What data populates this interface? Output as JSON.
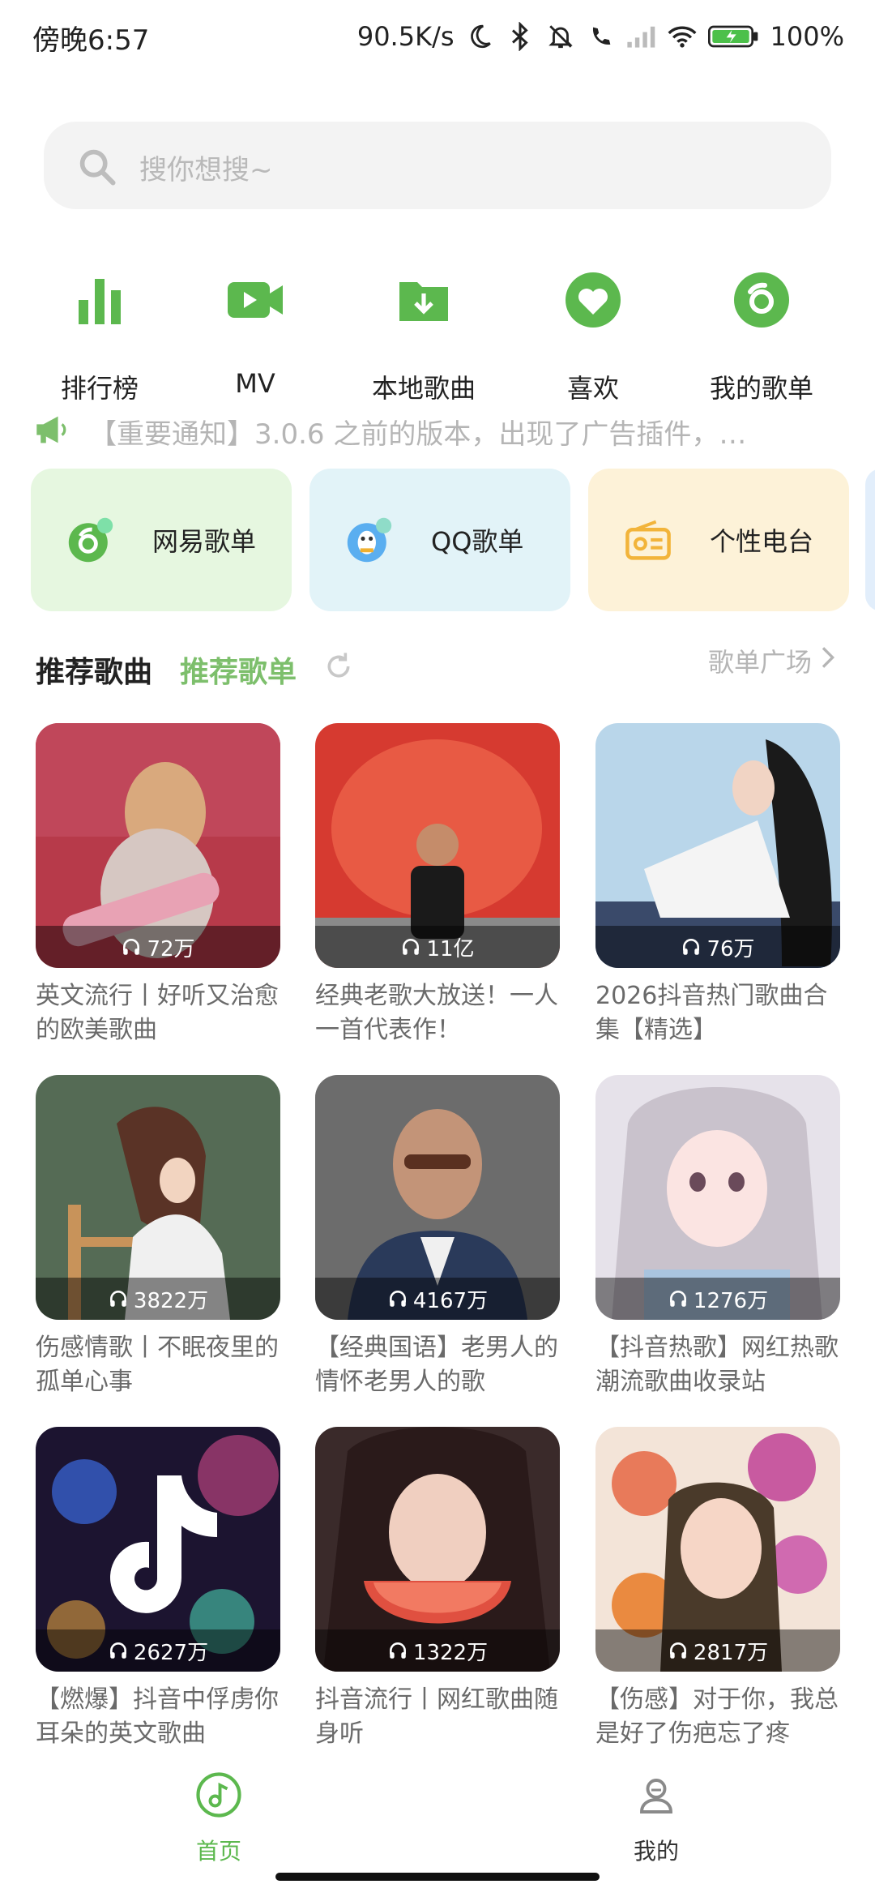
{
  "status_bar": {
    "time": "傍晚6:57",
    "net_speed": "90.5K/s",
    "battery": "100%"
  },
  "search": {
    "placeholder": "搜你想搜~"
  },
  "quick_nav": [
    {
      "label": "排行榜",
      "icon": "bar-chart-icon"
    },
    {
      "label": "MV",
      "icon": "video-camera-icon"
    },
    {
      "label": "本地歌曲",
      "icon": "folder-download-icon"
    },
    {
      "label": "喜欢",
      "icon": "heart-icon"
    },
    {
      "label": "我的歌单",
      "icon": "disc-icon"
    }
  ],
  "notice": {
    "text": "【重要通知】3.0.6 之前的版本，出现了广告插件，…"
  },
  "categories": [
    {
      "label": "网易歌单",
      "bg": "#e6f7e0",
      "icon": "netease-icon"
    },
    {
      "label": "QQ歌单",
      "bg": "#e2f3f8",
      "icon": "qq-penguin-icon"
    },
    {
      "label": "个性电台",
      "bg": "#fdf2d8",
      "icon": "radio-icon"
    }
  ],
  "section": {
    "tab_songs": "推荐歌曲",
    "tab_playlists": "推荐歌单",
    "plaza": "歌单广场"
  },
  "playlists": [
    {
      "plays": "72万",
      "title": "英文流行丨好听又治愈的欧美歌曲"
    },
    {
      "plays": "11亿",
      "title": "经典老歌大放送！一人一首代表作！"
    },
    {
      "plays": "76万",
      "title": "2026抖音热门歌曲合集【精选】"
    },
    {
      "plays": "3822万",
      "title": "伤感情歌丨不眠夜里的孤单心事"
    },
    {
      "plays": "4167万",
      "title": "【经典国语】老男人的情怀老男人的歌"
    },
    {
      "plays": "1276万",
      "title": "【抖音热歌】网红热歌潮流歌曲收录站"
    },
    {
      "plays": "2627万",
      "title": "【燃爆】抖音中俘虏你耳朵的英文歌曲"
    },
    {
      "plays": "1322万",
      "title": "抖音流行丨网红歌曲随身听"
    },
    {
      "plays": "2817万",
      "title": "【伤感】对于你，我总是好了伤疤忘了疼"
    }
  ],
  "bottom_nav": {
    "home": "首页",
    "mine": "我的"
  },
  "colors": {
    "accent": "#7dbf6c",
    "nav_green": "#5cb84e"
  }
}
